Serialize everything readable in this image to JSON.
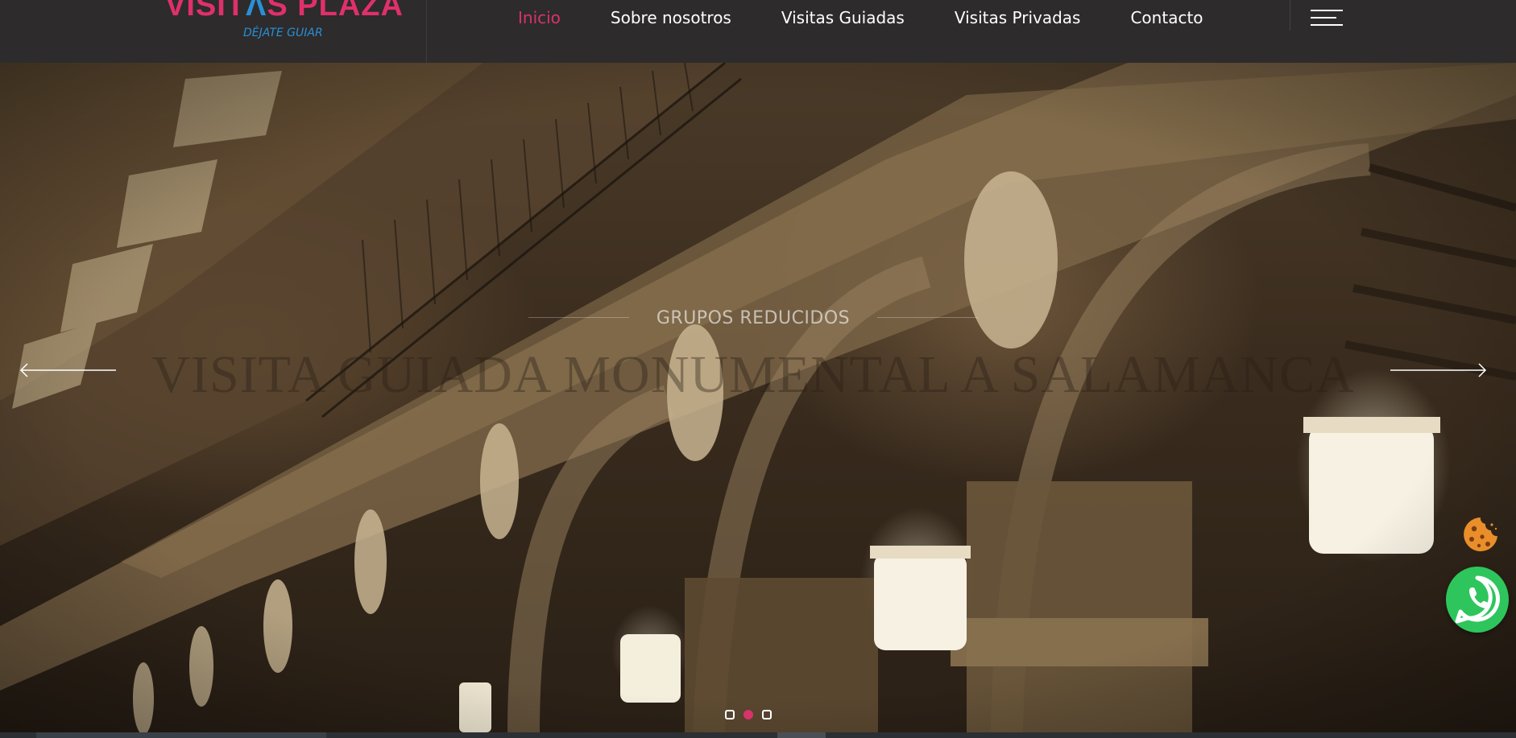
{
  "brand": {
    "name_part1": "VISIT",
    "name_accent": "Λ",
    "name_part2": "S PLAZA",
    "tagline": "DÉJATE GUIAR"
  },
  "nav": {
    "items": [
      {
        "label": "Inicio",
        "active": true
      },
      {
        "label": "Sobre nosotros",
        "active": false
      },
      {
        "label": "Visitas Guiadas",
        "active": false
      },
      {
        "label": "Visitas Privadas",
        "active": false
      },
      {
        "label": "Contacto",
        "active": false
      }
    ],
    "menu_icon": "hamburger-menu-icon"
  },
  "hero": {
    "kicker": "GRUPOS REDUCIDOS",
    "title": "VISITA GUIADA MONUMENTAL A SALAMANCA",
    "prev_icon": "arrow-left-icon",
    "next_icon": "arrow-right-icon",
    "slides_count": 3,
    "active_slide": 2
  },
  "floating": {
    "cookie_icon": "cookie-icon",
    "whatsapp_icon": "whatsapp-icon"
  },
  "colors": {
    "accent": "#d8336a",
    "header_bg": "#2d2b2b",
    "whatsapp": "#2ec55d",
    "logo_pink": "#e0306b",
    "logo_blue": "#2a8fd6"
  }
}
